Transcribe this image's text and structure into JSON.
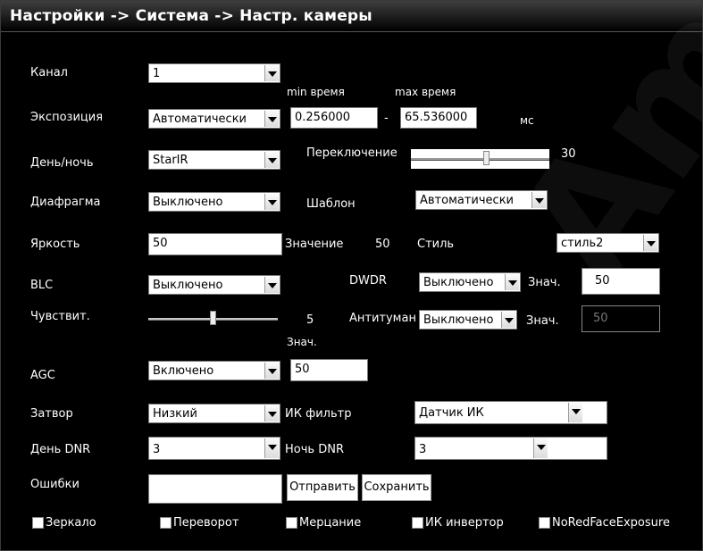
{
  "title": "Настройки -> Система -> Настр. камеры",
  "watermark": "Amat",
  "rows": {
    "channel": {
      "label": "Канал",
      "value": "1"
    },
    "exposure": {
      "label": "Экспозиция",
      "mode": "Автоматически",
      "min_label": "min время",
      "max_label": "max время",
      "min_value": "0.256000",
      "max_value": "65.536000",
      "dash": "-",
      "unit": "мс"
    },
    "daynight": {
      "label": "День/ночь",
      "mode": "StarIR",
      "switch_label": "Переключение",
      "switch_value": "30",
      "switch_level": 0.55
    },
    "iris": {
      "label": "Диафрагма",
      "value": "Выключено",
      "template_label": "Шаблон",
      "template_value": "Автоматически"
    },
    "brightness": {
      "label": "Яркость",
      "value": "50",
      "value_label": "Значение",
      "value_num": "50",
      "style_label": "Стиль",
      "style_value": "стиль2"
    },
    "blc": {
      "label": "BLC",
      "value": "Выключено",
      "dwdr_label": "DWDR",
      "dwdr_value": "Выключено",
      "dwdr_znach_label": "Знач.",
      "dwdr_znach_value": "50"
    },
    "sensitivity": {
      "label": "Чувствит.",
      "value": "5",
      "level": 0.5,
      "antifog_label": "Антитуман",
      "antifog_value": "Выключено",
      "antifog_znach_label": "Знач.",
      "antifog_znach_value": "50"
    },
    "agc": {
      "label": "AGC",
      "value": "Включено",
      "znach_label": "Знач.",
      "znach_value": "50"
    },
    "shutter": {
      "label": "Затвор",
      "value": "Низкий",
      "ir_label": "ИК фильтр",
      "ir_value": "Датчик ИК"
    },
    "dnr": {
      "label": "День DNR",
      "value": "3",
      "night_label": "Ночь DNR",
      "night_value": "3"
    },
    "errors": {
      "label": "Ошибки",
      "value": "",
      "send_button": "Отправить",
      "save_button": "Сохранить"
    }
  },
  "checkboxes": [
    {
      "label": "Зеркало"
    },
    {
      "label": "Переворот"
    },
    {
      "label": "Мерцание"
    },
    {
      "label": "ИК инвертор"
    },
    {
      "label": "NoRedFaceExposure"
    }
  ]
}
